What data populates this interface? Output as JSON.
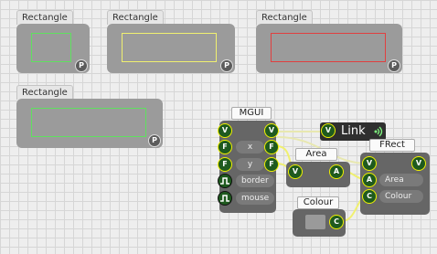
{
  "rectangles": [
    {
      "label": "Rectangle",
      "badge": "P",
      "color": "#5fe05f"
    },
    {
      "label": "Rectangle",
      "badge": "P",
      "color": "#f0f070"
    },
    {
      "label": "Rectangle",
      "badge": "P",
      "color": "#e04040"
    },
    {
      "label": "Rectangle",
      "badge": "P",
      "color": "#5fe05f"
    }
  ],
  "mgui": {
    "title": "MGUI",
    "ports": {
      "v": "V",
      "f": "F"
    },
    "rows": [
      "x",
      "y",
      "border",
      "mouse"
    ],
    "badge": "P"
  },
  "link": {
    "label": "Link",
    "port": "V"
  },
  "area": {
    "title": "Area",
    "in": "V",
    "out": "A"
  },
  "frect": {
    "title": "FRect",
    "rows": [
      "Area",
      "Colour"
    ],
    "in_v": "V",
    "in_a": "A",
    "in_c": "C",
    "out_v": "V"
  },
  "colour": {
    "title": "Colour",
    "out": "C"
  }
}
